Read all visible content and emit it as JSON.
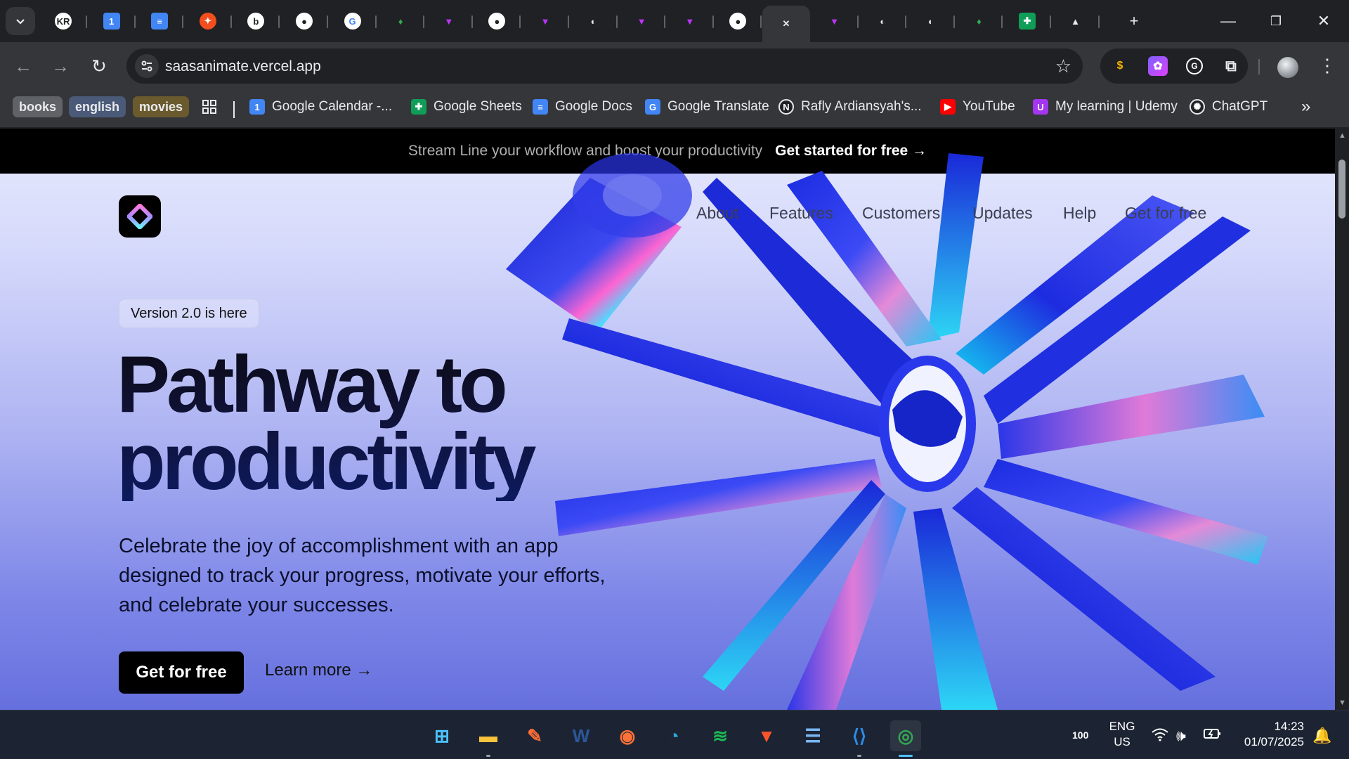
{
  "browser": {
    "tabs": [
      {
        "icon": "kr-avatar-icon",
        "glyph": "KR",
        "bg": "#ffffff",
        "fg": "#202124"
      },
      {
        "icon": "calendar-icon",
        "glyph": "1",
        "bg": "#4285f4",
        "fg": "#ffffff"
      },
      {
        "icon": "google-docs-icon",
        "glyph": "≡",
        "bg": "#4285f4",
        "fg": "#ffffff"
      },
      {
        "icon": "figma-icon",
        "glyph": "✦",
        "bg": "#f24e1e",
        "fg": "#ffffff"
      },
      {
        "icon": "b-logo-icon",
        "glyph": "b",
        "bg": "#ffffff",
        "fg": "#202124"
      },
      {
        "icon": "github-icon",
        "glyph": "●",
        "bg": "#ffffff",
        "fg": "#202124"
      },
      {
        "icon": "google-icon",
        "glyph": "G",
        "bg": "#ffffff",
        "fg": "#4285f4"
      },
      {
        "icon": "leaf-icon",
        "glyph": "♦",
        "bg": "#202124",
        "fg": "#34a853"
      },
      {
        "icon": "vite-icon",
        "glyph": "▼",
        "bg": "#202124",
        "fg": "#bd34fe"
      },
      {
        "icon": "github-icon",
        "glyph": "●",
        "bg": "#ffffff",
        "fg": "#202124"
      },
      {
        "icon": "vite-icon",
        "glyph": "▼",
        "bg": "#202124",
        "fg": "#bd34fe"
      },
      {
        "icon": "globe-icon",
        "glyph": "◐",
        "bg": "#202124",
        "fg": "#e8eaed"
      },
      {
        "icon": "vite-icon",
        "glyph": "▼",
        "bg": "#202124",
        "fg": "#bd34fe"
      },
      {
        "icon": "vite-icon",
        "glyph": "▼",
        "bg": "#202124",
        "fg": "#bd34fe"
      },
      {
        "icon": "github-icon",
        "glyph": "●",
        "bg": "#ffffff",
        "fg": "#202124"
      },
      {
        "icon": "close-icon",
        "glyph": "✕",
        "bg": "transparent",
        "fg": "#e8eaed",
        "active": true
      },
      {
        "icon": "vite-icon",
        "glyph": "▼",
        "bg": "#202124",
        "fg": "#bd34fe"
      },
      {
        "icon": "globe-icon",
        "glyph": "◐",
        "bg": "#202124",
        "fg": "#e8eaed"
      },
      {
        "icon": "globe-icon",
        "glyph": "◐",
        "bg": "#202124",
        "fg": "#e8eaed"
      },
      {
        "icon": "leaf-icon",
        "glyph": "♦",
        "bg": "#202124",
        "fg": "#34a853"
      },
      {
        "icon": "google-sheets-icon",
        "glyph": "✚",
        "bg": "#0f9d58",
        "fg": "#ffffff"
      },
      {
        "icon": "drive-icon",
        "glyph": "▲",
        "bg": "#202124",
        "fg": "#e8eaed"
      }
    ],
    "url": "saasanimate.vercel.app",
    "bookmark_folders": [
      "books",
      "english",
      "movies"
    ],
    "bookmarks": [
      {
        "label": "Google Calendar -...",
        "icon": "google-calendar-icon",
        "glyph": "1",
        "color": "#4285f4"
      },
      {
        "label": "Google Sheets",
        "icon": "google-sheets-icon",
        "glyph": "✚",
        "color": "#0f9d58"
      },
      {
        "label": "Google Docs",
        "icon": "google-docs-icon",
        "glyph": "≡",
        "color": "#4285f4"
      },
      {
        "label": "Google Translate",
        "icon": "google-translate-icon",
        "glyph": "G",
        "color": "#4285f4"
      },
      {
        "label": "Rafly Ardiansyah's...",
        "icon": "notion-icon",
        "glyph": "N",
        "color": "#202124"
      },
      {
        "label": "YouTube",
        "icon": "youtube-icon",
        "glyph": "▶",
        "color": "#ff0000"
      },
      {
        "label": "My learning | Udemy",
        "icon": "udemy-icon",
        "glyph": "U",
        "color": "#a435f0"
      },
      {
        "label": "ChatGPT",
        "icon": "chatgpt-icon",
        "glyph": "✺",
        "color": "#202124"
      }
    ]
  },
  "site": {
    "announcement": {
      "text": "Stream Line your workflow and boost your productivity",
      "cta": "Get started for free →"
    },
    "nav": [
      "About",
      "Features",
      "Customers",
      "Updates",
      "Help",
      "Get for free"
    ],
    "badge": "Version 2.0 is here",
    "title_line1": "Pathway to",
    "title_line2": "productivity",
    "subtitle": "Celebrate the joy of accomplishment with an app designed to track your progress, motivate your efforts, and celebrate your successes.",
    "primary_cta": "Get for free",
    "secondary_cta": "Learn more →"
  },
  "taskbar": {
    "apps": [
      {
        "icon": "windows-start-icon",
        "glyph": "⊞",
        "color": "#4cc2ff"
      },
      {
        "icon": "file-explorer-icon",
        "glyph": "▬",
        "color": "#f8c33a",
        "running": true
      },
      {
        "icon": "postman-icon",
        "glyph": "✎",
        "color": "#ff6c37"
      },
      {
        "icon": "word-icon",
        "glyph": "W",
        "color": "#2b579a"
      },
      {
        "icon": "firefox-icon",
        "glyph": "◉",
        "color": "#ff7139"
      },
      {
        "icon": "edge-icon",
        "glyph": "◔",
        "color": "#2ba8e0"
      },
      {
        "icon": "spotify-icon",
        "glyph": "≋",
        "color": "#1db954"
      },
      {
        "icon": "brave-icon",
        "glyph": "▼",
        "color": "#fb542b"
      },
      {
        "icon": "notepad-icon",
        "glyph": "☰",
        "color": "#7ab8f5"
      },
      {
        "icon": "vscode-icon",
        "glyph": "⟨⟩",
        "color": "#2d8be6",
        "running": true
      },
      {
        "icon": "chrome-icon",
        "glyph": "◎",
        "color": "#34a853",
        "running": true,
        "active": true
      }
    ],
    "battery_level": "100",
    "language": "ENG",
    "region": "US",
    "time": "14:23",
    "date": "01/07/2025"
  }
}
